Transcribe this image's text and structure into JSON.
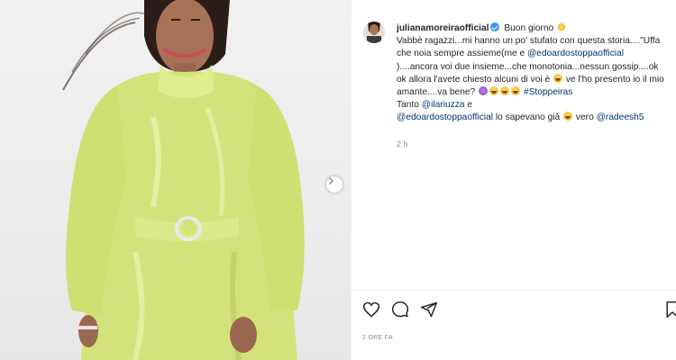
{
  "post": {
    "username": "julianamoreiraofficial",
    "verified": true,
    "caption": {
      "greeting": "Buon giorno",
      "text1": "Vabbè ragazzi...mi hanno un po' stufato con questa storia....\"Uffa che noia sempre assieme(me e",
      "mention1": "@edoardostoppaofficial",
      "text2": ")....ancora voi due insieme...che monotonia...nessun gossip....ok ok allora l'avete chiesto alcuni di voi è",
      "text3": "ve l'ho presento io il mio amante....va bene?",
      "hashtag": "#Stoppeiras",
      "tanto": "Tanto",
      "mention2": "@ilariuzza",
      "and": "e",
      "mention3": "@edoardostoppaofficial",
      "text4": "lo sapevano già",
      "vero": "vero",
      "mention4": "@radeesh5"
    },
    "relative_time": "2 h",
    "date_label": "2 ORE FA"
  },
  "icons": {
    "like": "heart-icon",
    "comment": "comment-icon",
    "share": "paper-plane-icon",
    "save": "bookmark-icon",
    "next": "chevron-right-icon"
  },
  "colors": {
    "link": "#00376b",
    "verified": "#3897f0",
    "dress": "#d6e47a"
  }
}
